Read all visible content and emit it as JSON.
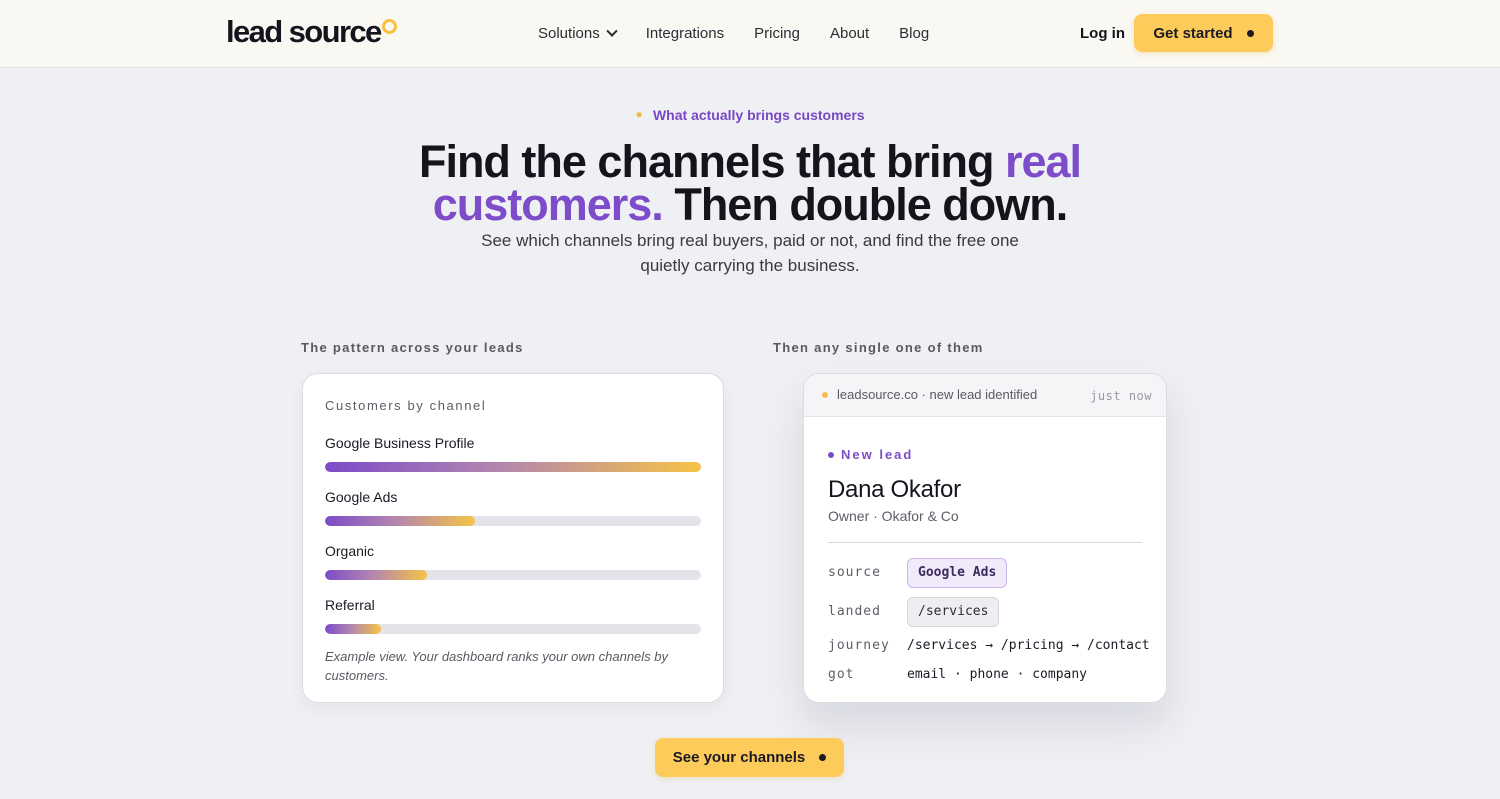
{
  "nav": {
    "logo_text": "lead source",
    "links": [
      "Solutions",
      "Integrations",
      "Pricing",
      "About",
      "Blog"
    ],
    "login_label": "Log in",
    "cta_label": "Get started",
    "brand_color": "#fccb5a"
  },
  "hero": {
    "eyebrow": "What actually brings customers",
    "title_part1": "Find the channels that bring ",
    "title_accent": "real customers.",
    "title_part2": " Then double down.",
    "subtitle": "See which channels bring real buyers, paid or not, and find the free one quietly carrying the business.",
    "accent_color": "#7d4cc9"
  },
  "left_section": {
    "label": "The pattern across your leads",
    "card_title": "Customers by channel",
    "channels": [
      {
        "name": "Google Business Profile",
        "share": 1.0
      },
      {
        "name": "Google Ads",
        "share": 0.4
      },
      {
        "name": "Organic",
        "share": 0.27
      },
      {
        "name": "Referral",
        "share": 0.15
      }
    ],
    "footnote": "Example view. Your dashboard ranks your own channels by customers."
  },
  "right_section": {
    "label": "Then any single one of them",
    "header_text": "leadsource.co · new lead identified",
    "header_time": "just now",
    "badge": "New lead",
    "lead_name": "Dana Okafor",
    "lead_role": "Owner · Okafor & Co",
    "fields": {
      "source_key": "source",
      "source_val": "Google Ads",
      "landed_key": "landed",
      "landed_val": "/services",
      "journey_key": "journey",
      "journey_val": "/services → /pricing → /contact",
      "got_key": "got",
      "got_val": "email · phone · company"
    }
  },
  "cta": {
    "label": "See your channels"
  }
}
